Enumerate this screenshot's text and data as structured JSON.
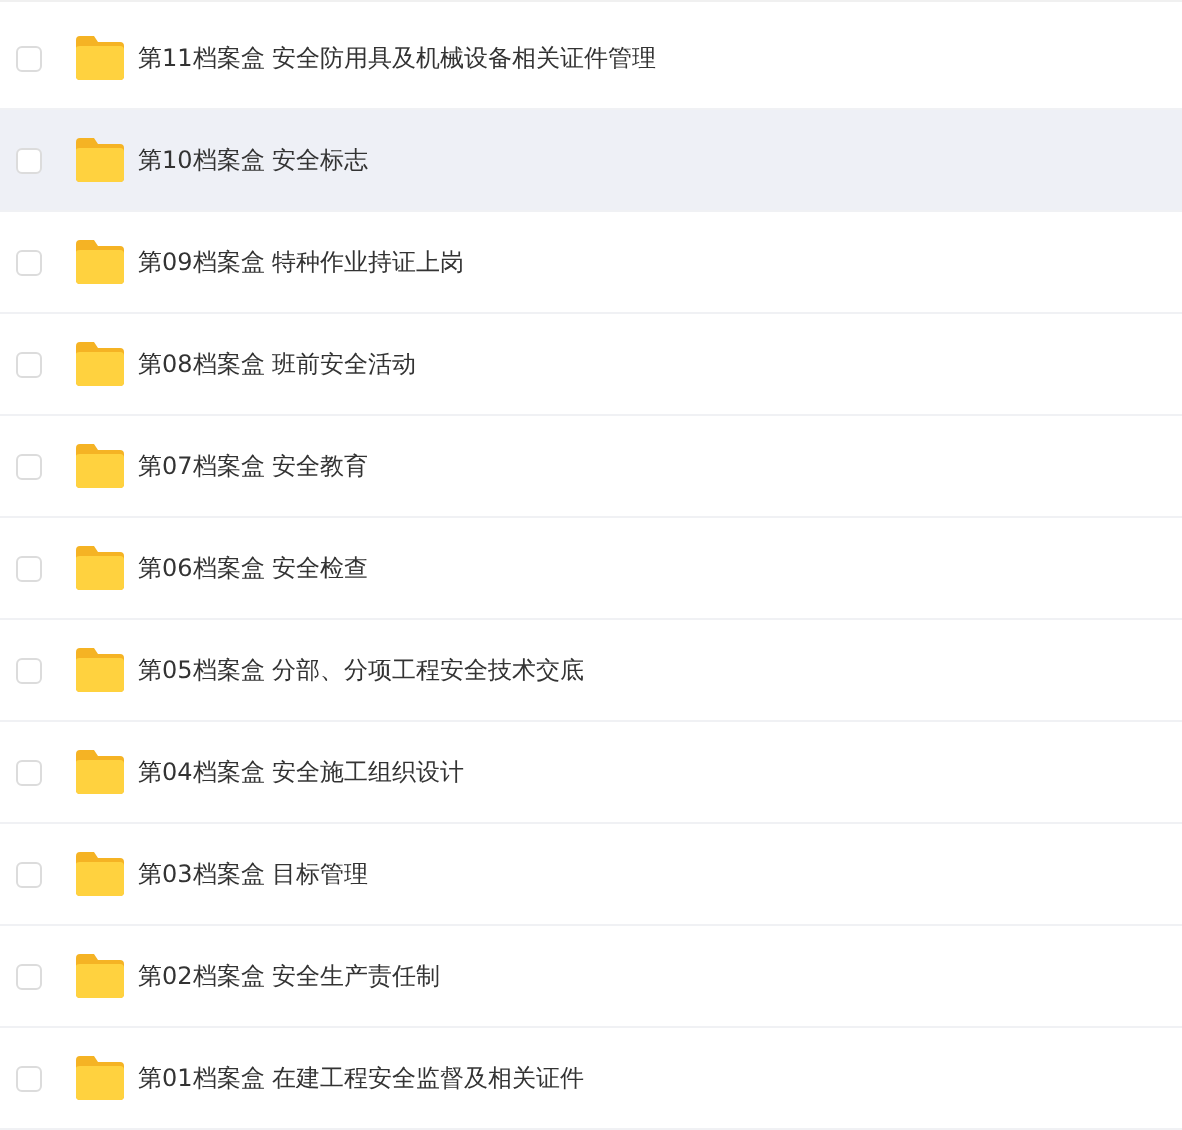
{
  "folders": [
    {
      "name": "第11档案盒 安全防用具及机械设备相关证件管理",
      "checked": false,
      "selected": false
    },
    {
      "name": "第10档案盒 安全标志",
      "checked": false,
      "selected": true
    },
    {
      "name": "第09档案盒 特种作业持证上岗",
      "checked": false,
      "selected": false
    },
    {
      "name": "第08档案盒 班前安全活动",
      "checked": false,
      "selected": false
    },
    {
      "name": "第07档案盒 安全教育",
      "checked": false,
      "selected": false
    },
    {
      "name": "第06档案盒 安全检查",
      "checked": false,
      "selected": false
    },
    {
      "name": "第05档案盒 分部、分项工程安全技术交底",
      "checked": false,
      "selected": false
    },
    {
      "name": "第04档案盒 安全施工组织设计",
      "checked": false,
      "selected": false
    },
    {
      "name": "第03档案盒 目标管理",
      "checked": false,
      "selected": false
    },
    {
      "name": "第02档案盒 安全生产责任制",
      "checked": false,
      "selected": false
    },
    {
      "name": "第01档案盒 在建工程安全监督及相关证件",
      "checked": false,
      "selected": false
    }
  ]
}
